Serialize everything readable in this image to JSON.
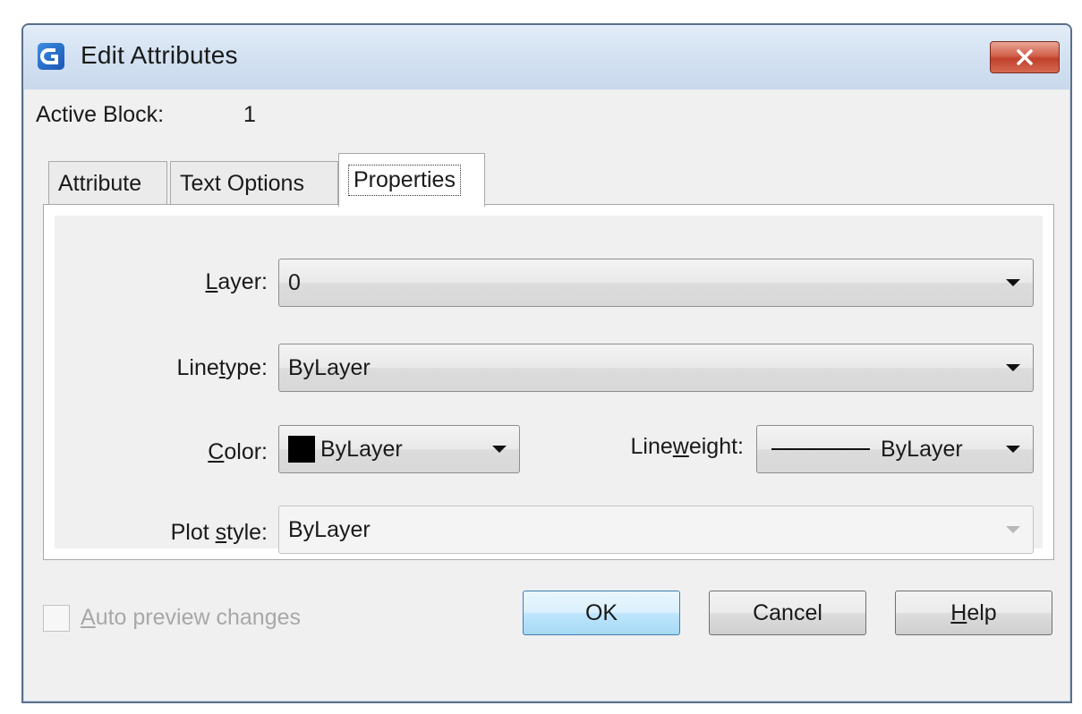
{
  "window": {
    "title": "Edit Attributes",
    "close_symbol": "×"
  },
  "active_block": {
    "label": "Active Block:",
    "value": "1"
  },
  "tabs": [
    {
      "label": "Attribute",
      "selected": false
    },
    {
      "label": "Text Options",
      "selected": false
    },
    {
      "label": "Properties",
      "selected": true
    }
  ],
  "properties": {
    "layer": {
      "label_pre": "",
      "label_u": "L",
      "label_post": "ayer:",
      "value": "0"
    },
    "linetype": {
      "label_pre": "Line",
      "label_u": "t",
      "label_post": "ype:",
      "value": "ByLayer"
    },
    "color": {
      "label_pre": "",
      "label_u": "C",
      "label_post": "olor:",
      "value": "ByLayer",
      "swatch": "#000000"
    },
    "lineweight": {
      "label_pre": "Line",
      "label_u": "w",
      "label_post": "eight:",
      "value": "ByLayer"
    },
    "plot_style": {
      "label_pre": "Plot ",
      "label_u": "s",
      "label_post": "tyle:",
      "value": "ByLayer",
      "enabled": false
    }
  },
  "auto_preview": {
    "label_u": "A",
    "label_rest": "uto preview changes",
    "checked": false,
    "enabled": false
  },
  "buttons": {
    "ok": "OK",
    "cancel": "Cancel",
    "help_u": "H",
    "help_rest": "elp"
  },
  "icons": {
    "app": "app-logo-icon",
    "close": "close-icon",
    "dropdown": "chevron-down-icon"
  },
  "colors": {
    "close_button": "#c9472f",
    "ok_button": "#bee6fd",
    "titlebar": "#d4e2f2"
  }
}
